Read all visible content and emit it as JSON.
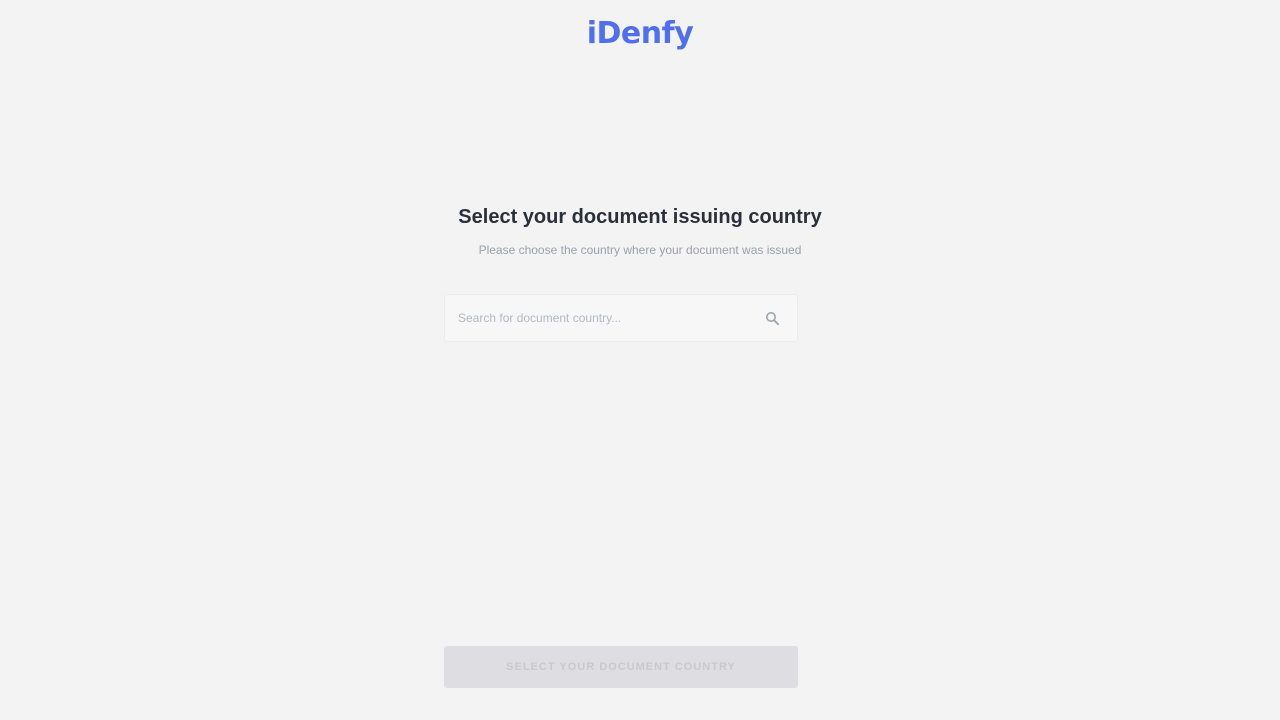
{
  "brand": {
    "logo_text": "iDenfy",
    "logo_color": "#4f6ff0"
  },
  "main": {
    "title": "Select your document issuing country",
    "subtitle": "Please choose the country where your document was issued"
  },
  "search": {
    "placeholder": "Search for document country...",
    "value": "",
    "icon": "search-icon"
  },
  "footer": {
    "button_label": "SELECT YOUR DOCUMENT COUNTRY",
    "button_state": "disabled"
  }
}
